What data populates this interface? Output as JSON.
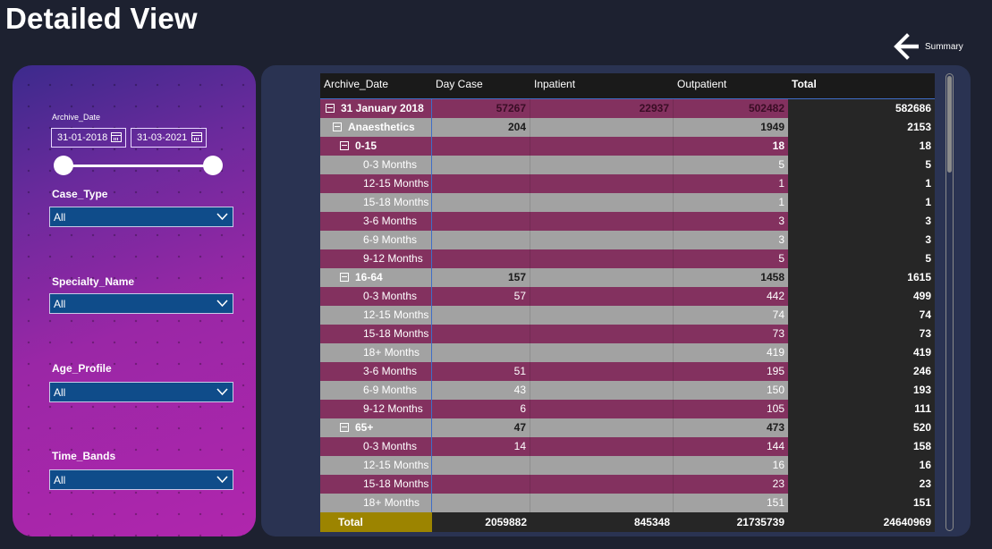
{
  "page": {
    "title": "Detailed View"
  },
  "nav": {
    "back_label": "Summary",
    "back_icon": "arrow-left-icon"
  },
  "filters": {
    "archive_date": {
      "label": "Archive_Date",
      "start": "31-01-2018",
      "end": "31-03-2021",
      "range_fraction": [
        0,
        1
      ]
    },
    "case_type": {
      "label": "Case_Type",
      "value": "All"
    },
    "specialty_name": {
      "label": "Specialty_Name",
      "value": "All"
    },
    "age_profile": {
      "label": "Age_Profile",
      "value": "All"
    },
    "time_bands": {
      "label": "Time_Bands",
      "value": "All"
    }
  },
  "table": {
    "columns": [
      "Archive_Date",
      "Day Case",
      "Inpatient",
      "Outpatient",
      "Total"
    ],
    "rows": [
      {
        "label": "31 January 2018",
        "level": 0,
        "expand": true,
        "bold": true,
        "day_case": "57267",
        "inpatient": "22937",
        "outpatient": "502482",
        "total": "582686"
      },
      {
        "label": "Anaesthetics",
        "level": 1,
        "expand": true,
        "bold": true,
        "day_case": "204",
        "inpatient": "",
        "outpatient": "1949",
        "total": "2153"
      },
      {
        "label": "0-15",
        "level": 2,
        "expand": true,
        "bold": true,
        "day_case": "",
        "inpatient": "",
        "outpatient": "18",
        "total": "18"
      },
      {
        "label": "0-3 Months",
        "level": 3,
        "expand": false,
        "bold": false,
        "day_case": "",
        "inpatient": "",
        "outpatient": "5",
        "total": "5"
      },
      {
        "label": "12-15 Months",
        "level": 3,
        "expand": false,
        "bold": false,
        "day_case": "",
        "inpatient": "",
        "outpatient": "1",
        "total": "1"
      },
      {
        "label": "15-18 Months",
        "level": 3,
        "expand": false,
        "bold": false,
        "day_case": "",
        "inpatient": "",
        "outpatient": "1",
        "total": "1"
      },
      {
        "label": "3-6 Months",
        "level": 3,
        "expand": false,
        "bold": false,
        "day_case": "",
        "inpatient": "",
        "outpatient": "3",
        "total": "3"
      },
      {
        "label": "6-9 Months",
        "level": 3,
        "expand": false,
        "bold": false,
        "day_case": "",
        "inpatient": "",
        "outpatient": "3",
        "total": "3"
      },
      {
        "label": "9-12 Months",
        "level": 3,
        "expand": false,
        "bold": false,
        "day_case": "",
        "inpatient": "",
        "outpatient": "5",
        "total": "5"
      },
      {
        "label": "16-64",
        "level": 2,
        "expand": true,
        "bold": true,
        "day_case": "157",
        "inpatient": "",
        "outpatient": "1458",
        "total": "1615"
      },
      {
        "label": "0-3 Months",
        "level": 3,
        "expand": false,
        "bold": false,
        "day_case": "57",
        "inpatient": "",
        "outpatient": "442",
        "total": "499"
      },
      {
        "label": "12-15 Months",
        "level": 3,
        "expand": false,
        "bold": false,
        "day_case": "",
        "inpatient": "",
        "outpatient": "74",
        "total": "74"
      },
      {
        "label": "15-18 Months",
        "level": 3,
        "expand": false,
        "bold": false,
        "day_case": "",
        "inpatient": "",
        "outpatient": "73",
        "total": "73"
      },
      {
        "label": "18+ Months",
        "level": 3,
        "expand": false,
        "bold": false,
        "day_case": "",
        "inpatient": "",
        "outpatient": "419",
        "total": "419"
      },
      {
        "label": "3-6 Months",
        "level": 3,
        "expand": false,
        "bold": false,
        "day_case": "51",
        "inpatient": "",
        "outpatient": "195",
        "total": "246"
      },
      {
        "label": "6-9 Months",
        "level": 3,
        "expand": false,
        "bold": false,
        "day_case": "43",
        "inpatient": "",
        "outpatient": "150",
        "total": "193"
      },
      {
        "label": "9-12 Months",
        "level": 3,
        "expand": false,
        "bold": false,
        "day_case": "6",
        "inpatient": "",
        "outpatient": "105",
        "total": "111"
      },
      {
        "label": "65+",
        "level": 2,
        "expand": true,
        "bold": true,
        "day_case": "47",
        "inpatient": "",
        "outpatient": "473",
        "total": "520"
      },
      {
        "label": "0-3 Months",
        "level": 3,
        "expand": false,
        "bold": false,
        "day_case": "14",
        "inpatient": "",
        "outpatient": "144",
        "total": "158"
      },
      {
        "label": "12-15 Months",
        "level": 3,
        "expand": false,
        "bold": false,
        "day_case": "",
        "inpatient": "",
        "outpatient": "16",
        "total": "16"
      },
      {
        "label": "15-18 Months",
        "level": 3,
        "expand": false,
        "bold": false,
        "day_case": "",
        "inpatient": "",
        "outpatient": "23",
        "total": "23"
      },
      {
        "label": "18+ Months",
        "level": 3,
        "expand": false,
        "bold": false,
        "day_case": "",
        "inpatient": "",
        "outpatient": "151",
        "total": "151"
      }
    ],
    "totals": {
      "label": "Total",
      "day_case": "2059882",
      "inpatient": "845348",
      "outpatient": "21735739",
      "total": "24640969"
    }
  },
  "colors": {
    "page_background": "#1d2130",
    "row_pink": "#83315f",
    "row_grey": "#a2a2a2",
    "total_label_gold": "#9c8400",
    "dropdown_blue": "#0f4c8a",
    "panel_purple": "#9a27a6"
  }
}
